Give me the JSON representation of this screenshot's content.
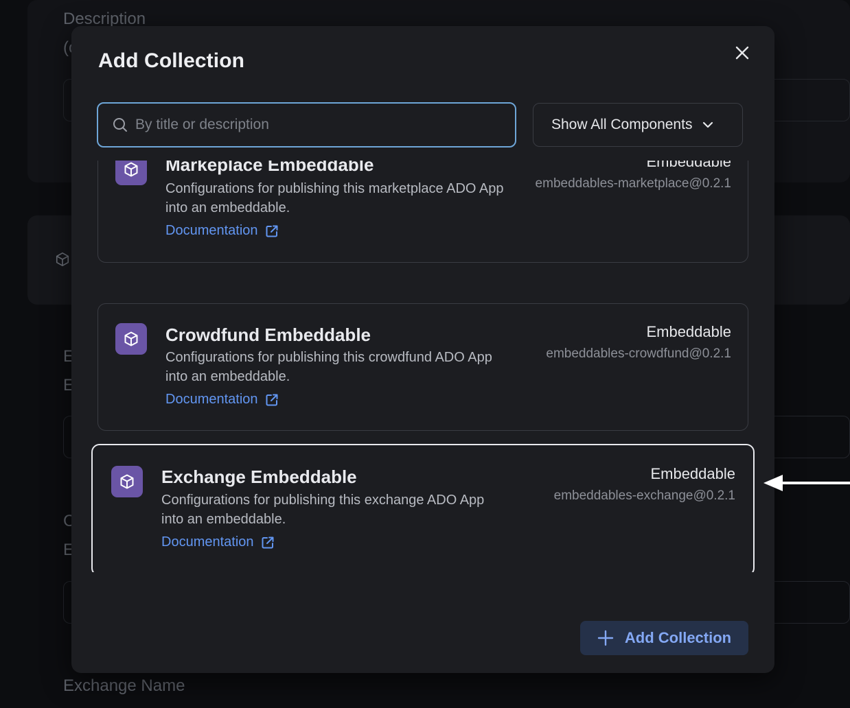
{
  "background": {
    "description_label": "Description",
    "description_sub": "(o",
    "section_letter_e": "E",
    "section_letter_e2": "E",
    "section_letter_c": "C",
    "section_letter_e3": "E",
    "exchange_name_label": "Exchange Name"
  },
  "modal": {
    "title": "Add Collection",
    "search": {
      "placeholder": "By title or description",
      "value": ""
    },
    "filter": {
      "selected": "Show All Components"
    },
    "items": [
      {
        "title": "Markeplace Embeddable",
        "description": "Configurations for publishing this marketplace ADO App into an embeddable.",
        "link": "Documentation",
        "type": "Embeddable",
        "package": "embeddables-marketplace@0.2.1"
      },
      {
        "title": "Crowdfund Embeddable",
        "description": "Configurations for publishing this crowdfund ADO App into an embeddable.",
        "link": "Documentation",
        "type": "Embeddable",
        "package": "embeddables-crowdfund@0.2.1"
      },
      {
        "title": "Exchange Embeddable",
        "description": "Configurations for publishing this exchange ADO App into an embeddable.",
        "link": "Documentation",
        "type": "Embeddable",
        "package": "embeddables-exchange@0.2.1"
      }
    ],
    "add_button": "Add Collection"
  },
  "colors": {
    "accent": "#6296f2",
    "badge": "#6a55a6",
    "modal_bg": "#1c1d21",
    "page_bg": "#0c0d10"
  },
  "icons": [
    "search-icon",
    "close-icon",
    "chevron-down-icon",
    "cube-icon",
    "external-link-icon",
    "plus-icon",
    "arrow-left-icon"
  ]
}
